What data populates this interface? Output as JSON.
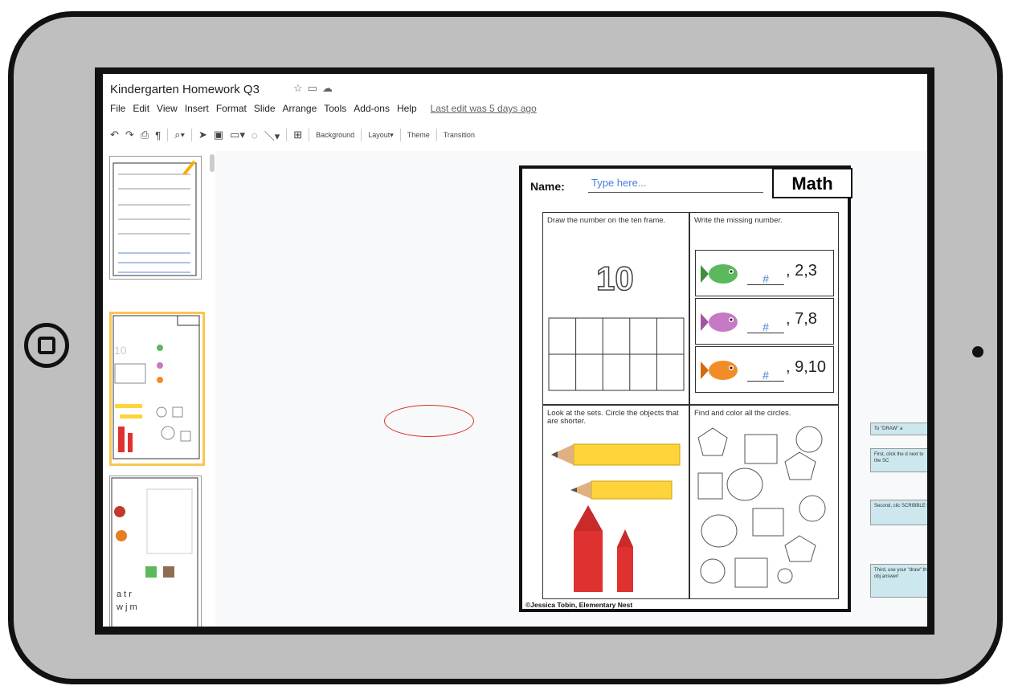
{
  "app": {
    "title": "Kindergarten Homework Q3",
    "menus": [
      "File",
      "Edit",
      "View",
      "Insert",
      "Format",
      "Slide",
      "Arrange",
      "Tools",
      "Add-ons",
      "Help"
    ],
    "last_edit": "Last edit was 5 days ago"
  },
  "toolbar": {
    "background_label": "Background",
    "layout_label": "Layout",
    "theme_label": "Theme",
    "transition_label": "Transition"
  },
  "slide": {
    "name_label": "Name:",
    "name_placeholder": "Type here...",
    "subject": "Math",
    "q1": "Draw the number on the ten frame.",
    "q1_number": "10",
    "q2": "Write the missing number.",
    "fish_rows": [
      {
        "blank": "#",
        "nums": ", 2,3",
        "color": "#5cb85c"
      },
      {
        "blank": "#",
        "nums": ", 7,8",
        "color": "#c679c4"
      },
      {
        "blank": "#",
        "nums": ", 9,10",
        "color": "#f28c28"
      }
    ],
    "q3": "Look at the sets. Circle the objects that are shorter.",
    "q4": "Find and color all the circles.",
    "copyright": "©Jessica Tobin, Elementary Nest"
  },
  "side_notes": [
    "To \"DRAW\" a",
    "First, click the d next to the SC",
    "Second, clic SCRIBBLE t",
    "Third, use your \"draw\" the obj answer!"
  ],
  "colors": {
    "accent": "#f9c74f",
    "link": "#4a7ed8",
    "crayon": "#e03131",
    "pencil": "#ffd43b"
  }
}
